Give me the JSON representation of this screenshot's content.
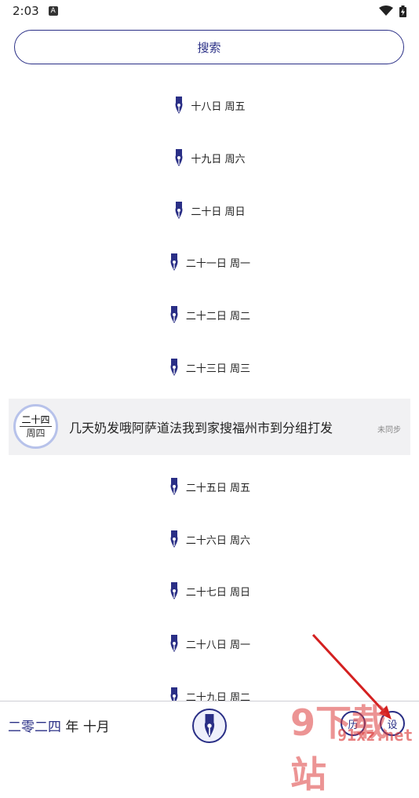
{
  "status_bar": {
    "time": "2:03",
    "a_icon": "A"
  },
  "search": {
    "label": "搜索"
  },
  "days_before": [
    "十八日 周五",
    "十九日 周六",
    "二十日 周日",
    "二十一日 周一",
    "二十二日 周二",
    "二十三日 周三"
  ],
  "entry": {
    "day": "二十四",
    "weekday": "周四",
    "text": "几天奶发哦阿萨道法我到家搜福州市到分组打发",
    "status": "未同步"
  },
  "days_after": [
    "二十五日 周五",
    "二十六日 周六",
    "二十七日 周日",
    "二十八日 周一",
    "二十九日 周二"
  ],
  "bottom": {
    "year": "二零二四",
    "year_unit": "年",
    "month": "十月",
    "calendar_btn": "历",
    "settings_btn": "设"
  },
  "watermark": {
    "big": "9下载站",
    "small": "91xz.net"
  },
  "colors": {
    "accent": "#2a2f86",
    "entry_bg": "#f1f1f3",
    "badge_ring": "#b7c2ea"
  }
}
